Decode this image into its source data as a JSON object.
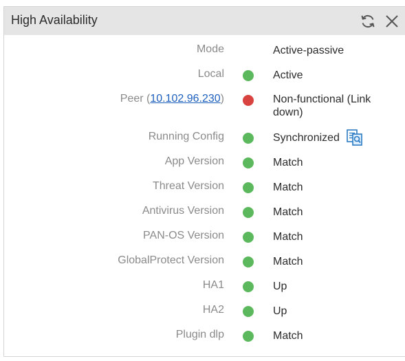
{
  "widget": {
    "title": "High Availability",
    "icons": {
      "refresh": "refresh-icon",
      "close": "close-icon",
      "sync_details": "config-compare-icon"
    }
  },
  "colors": {
    "ok": "#5cb85c",
    "error": "#d9433f",
    "link": "#1d5fbf"
  },
  "rows": [
    {
      "label": "Mode",
      "value": "Active-passive",
      "status": "none"
    },
    {
      "label": "Local",
      "value": "Active",
      "status": "ok"
    },
    {
      "label_prefix": "Peer (",
      "label_link": "10.102.96.230",
      "label_suffix": ")",
      "value": "Non-functional (Link down)",
      "status": "error"
    },
    {
      "label": "Running Config",
      "value": "Synchronized",
      "status": "ok"
    },
    {
      "label": "App Version",
      "value": "Match",
      "status": "ok"
    },
    {
      "label": "Threat Version",
      "value": "Match",
      "status": "ok"
    },
    {
      "label": "Antivirus Version",
      "value": "Match",
      "status": "ok"
    },
    {
      "label": "PAN-OS Version",
      "value": "Match",
      "status": "ok"
    },
    {
      "label": "GlobalProtect Version",
      "value": "Match",
      "status": "ok"
    },
    {
      "label": "HA1",
      "value": "Up",
      "status": "ok"
    },
    {
      "label": "HA2",
      "value": "Up",
      "status": "ok"
    },
    {
      "label": "Plugin dlp",
      "value": "Match",
      "status": "ok"
    }
  ]
}
